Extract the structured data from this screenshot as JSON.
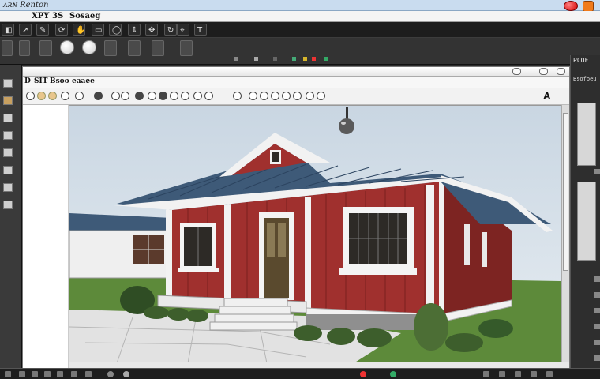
{
  "window": {
    "title": "ᴀʀɴ Renton"
  },
  "menubar": {
    "items": [
      "XPY",
      "3S",
      "Sosaeg"
    ]
  },
  "document": {
    "menu": [
      "D",
      "SIT",
      "Bsoo",
      "eaaee"
    ]
  },
  "right_panel": {
    "title": "PCOF",
    "subtitle": "Bsofoeu"
  },
  "colors": {
    "accent_red": "#d40000",
    "accent_orange": "#f07a1a",
    "roof_blue": "#3e5a78",
    "wall_red": "#a0302e",
    "lawn_green": "#5d8a3a"
  },
  "icons": [
    "app-logo-icon",
    "close-icon",
    "search-icon",
    "orbit-icon",
    "pan-icon",
    "zoom-icon",
    "select-icon",
    "paint-bucket-icon",
    "push-pull-icon",
    "rotate-icon",
    "tape-measure-icon",
    "text-icon"
  ]
}
